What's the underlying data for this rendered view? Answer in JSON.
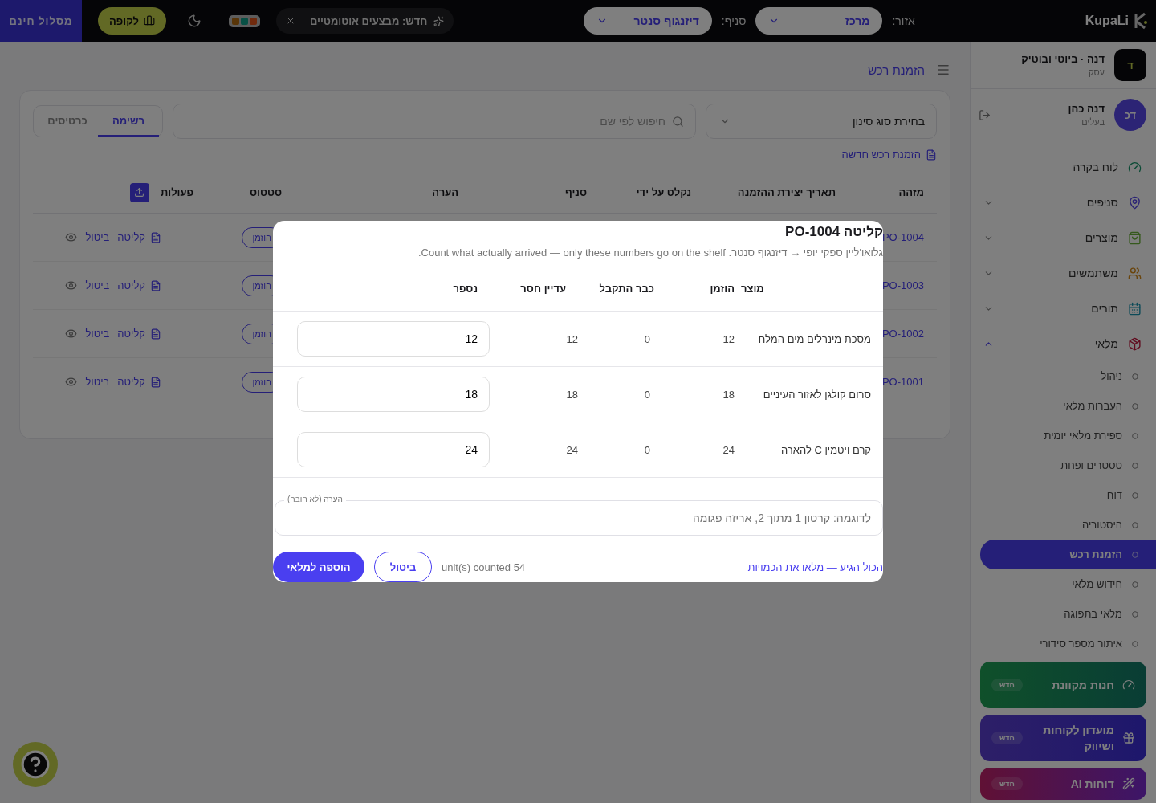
{
  "topbar": {
    "logo": "KupaLi",
    "region_label": "אזור:",
    "region_value": "מרכז",
    "branch_label": "סניף:",
    "branch_value": "דיזנגוף סנטר",
    "announcement": "חדש: מבצעים אוטומטיים",
    "cashier_button": "לקופה",
    "plan_button": "מסלול חינם"
  },
  "sidebar": {
    "business": {
      "initial": "ד",
      "name": "דנה · ביוטי ובוטיק",
      "role": "עסק"
    },
    "user": {
      "initials": "דכ",
      "name": "דנה כהן",
      "role": "בעלים"
    },
    "nav": [
      {
        "label": "לוח בקרה"
      },
      {
        "label": "סניפים",
        "expanded": false
      },
      {
        "label": "מוצרים",
        "expanded": false
      },
      {
        "label": "משתמשים",
        "expanded": false
      },
      {
        "label": "תורים",
        "expanded": false
      },
      {
        "label": "מלאי",
        "expanded": true,
        "children": [
          {
            "label": "ניהול",
            "selected": false
          },
          {
            "label": "העברות מלאי",
            "selected": false
          },
          {
            "label": "ספירת מלאי יומית",
            "selected": false
          },
          {
            "label": "טסטרים ופחת",
            "selected": false
          },
          {
            "label": "דוח",
            "selected": false
          },
          {
            "label": "היסטוריה",
            "selected": false
          },
          {
            "label": "הזמנת רכש",
            "selected": true
          },
          {
            "label": "חידוש מלאי",
            "selected": false
          },
          {
            "label": "מלאי בתפוגה",
            "selected": false
          },
          {
            "label": "איתור מספר סידורי",
            "selected": false
          }
        ]
      }
    ],
    "promos": [
      {
        "kind": "store",
        "label": "חנות מקוונת",
        "badge": "חדש"
      },
      {
        "kind": "club",
        "label": "מועדון לקוחות ושיווק",
        "badge": "חדש"
      },
      {
        "kind": "reports",
        "label": "דוחות AI",
        "badge": "חדש"
      }
    ]
  },
  "main": {
    "breadcrumb": "הזמנת רכש",
    "filter": {
      "placeholder": "בחירת סוג סינון"
    },
    "search": {
      "placeholder": "חיפוש לפי שם"
    },
    "view_tabs": [
      {
        "label": "רשימה",
        "selected": true
      },
      {
        "label": "כרטיסים",
        "selected": false
      }
    ],
    "new_order_link": "הזמנת רכש חדשה",
    "table": {
      "columns": [
        "מזהה",
        "תאריך יצירת ההזמנה",
        "נקלט על ידי",
        "סניף",
        "הערה",
        "סטטוס",
        "פעולות"
      ],
      "rows": [
        {
          "id": "PO-1004",
          "status": "הוזמן",
          "actions": [
            "קליטה",
            "ביטול"
          ]
        },
        {
          "id": "PO-1003",
          "status": "הוזמן",
          "actions": [
            "קליטה",
            "ביטול"
          ]
        },
        {
          "id": "PO-1002",
          "status": "הוזמן",
          "actions": [
            "קליטה",
            "ביטול"
          ]
        },
        {
          "id": "PO-1001",
          "status": "הוזמן",
          "actions": [
            "קליטה",
            "ביטול"
          ]
        }
      ]
    }
  },
  "modal": {
    "title": "קליטה PO-1004",
    "subtitle": "גלואו'ליין ספקי יופי → דיזנגוף סנטר. Count what actually arrived — only these numbers go on the shelf.",
    "columns": [
      "מוצר",
      "הוזמן",
      "כבר התקבל",
      "עדיין חסר",
      "נספר"
    ],
    "rows": [
      {
        "product": "מסכת מינרלים מים המלח",
        "ordered": "12",
        "received": "0",
        "missing": "12",
        "count": "12"
      },
      {
        "product": "סרום קולגן לאזור העיניים",
        "ordered": "18",
        "received": "0",
        "missing": "18",
        "count": "18"
      },
      {
        "product": "קרם ויטמין C להארה",
        "ordered": "24",
        "received": "0",
        "missing": "24",
        "count": "24"
      }
    ],
    "note": {
      "label": "הערה (לא חובה)",
      "placeholder": "לדוגמה: קרטון 1 מתוך 2, אריזה פגומה"
    },
    "fill_all_link": "הכול הגיע — מלאו את הכמויות",
    "counted": "54 unit(s) counted",
    "cancel_button": "ביטול",
    "submit_button": "הוספה למלאי"
  }
}
